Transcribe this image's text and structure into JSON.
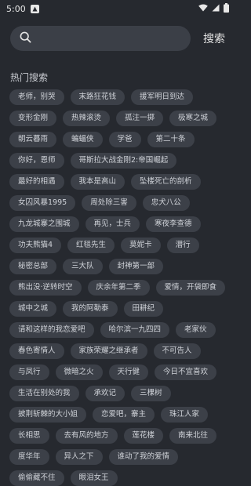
{
  "status": {
    "time": "5:00"
  },
  "search": {
    "placeholder": "",
    "button_label": "搜索"
  },
  "hot": {
    "title": "热门搜索",
    "tags": [
      "老师，别哭",
      "末路狂花钱",
      "援军明日到达",
      "变形金刚",
      "热辣滚烫",
      "孤注一掷",
      "极寒之城",
      "朝云暮雨",
      "蝙蝠侠",
      "学爸",
      "第二十条",
      "你好，恩师",
      "哥斯拉大战金刚2:帝国崛起",
      "最好的相遇",
      "我本是高山",
      "坠楼死亡的剖析",
      "女囚风暴1995",
      "周处除三害",
      "忠犬八公",
      "九龙城寨之围城",
      "再见，士兵",
      "寒夜李查德",
      "功夫熊猫4",
      "红毯先生",
      "莫妮卡",
      "潜行",
      "秘密总部",
      "三大队",
      "封神第一部",
      "熊出没·逆转时空",
      "庆余年第二季",
      "爱情，开袋即食",
      "城中之城",
      "我的阿勒泰",
      "田耕纪",
      "请和这样的我恋爱吧",
      "哈尔滨一九四四",
      "老家伙",
      "春色寄情人",
      "家族荣耀之继承者",
      "不可告人",
      "与凤行",
      "微暗之火",
      "天行健",
      "今日不宜喜欢",
      "生活在别处的我",
      "承欢记",
      "三棵树",
      "披荆斩棘的大小姐",
      "恋爱吧，寨主",
      "珠江人家",
      "长相思",
      "去有风的地方",
      "莲花楼",
      "南来北往",
      "度华年",
      "异人之下",
      "谁动了我的爱情",
      "偷偷藏不住",
      "眼泪女王"
    ]
  }
}
